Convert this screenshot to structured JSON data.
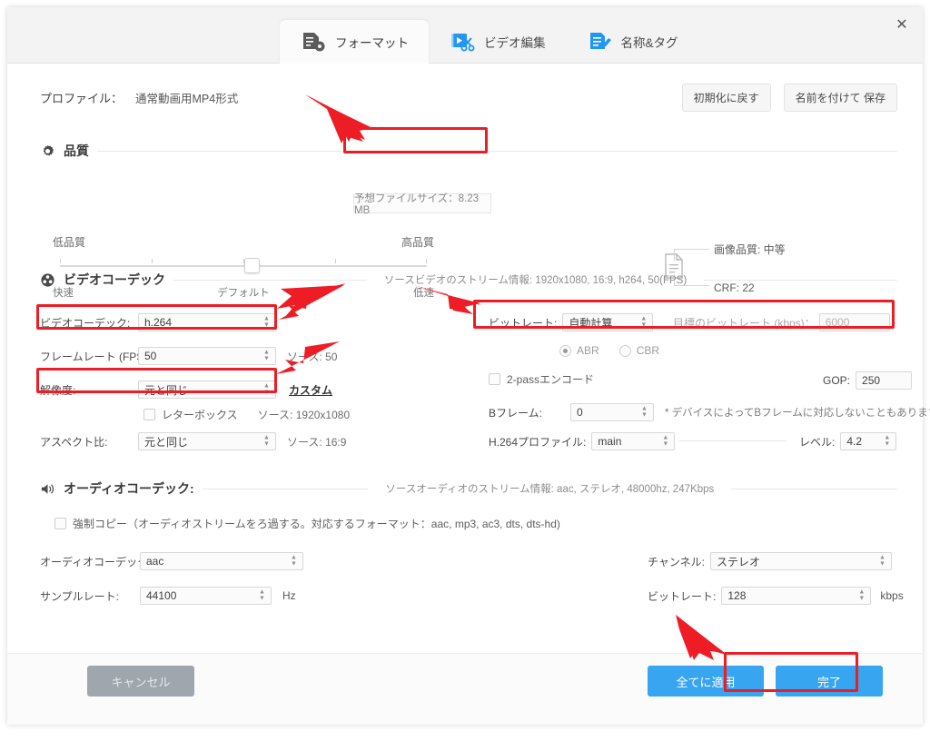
{
  "window": {
    "close_label": "✕"
  },
  "tabs": [
    {
      "label": "フォーマット",
      "icon": "format-icon",
      "active": true
    },
    {
      "label": "ビデオ編集",
      "icon": "video-edit-icon",
      "active": false
    },
    {
      "label": "名称&タグ",
      "icon": "name-tag-icon",
      "active": false
    }
  ],
  "profile": {
    "label": "プロファイル：",
    "value": "通常動画用MP4形式"
  },
  "top_buttons": {
    "reset": "初期化に戻す",
    "save_as": "名前を付けて 保存"
  },
  "quality": {
    "section_title": "品質",
    "estimate": "予想ファイルサイズ：8.23 MB",
    "slider": {
      "left_top": "低品質",
      "right_top": "高品質",
      "left_bottom": "快速",
      "center_bottom": "デフォルト",
      "right_bottom": "低速",
      "value_percent": 50
    },
    "info": {
      "image_quality": "画像品質: 中等",
      "crf": "CRF: 22"
    }
  },
  "video": {
    "section_title": "ビデオコーデック",
    "source_info": "ソースビデオのストリーム情報: 1920x1080, 16:9, h264, 50(FPS)",
    "codec": {
      "label": "ビデオコーデック:",
      "value": "h.264"
    },
    "framerate": {
      "label": "フレームレート (FPS)：",
      "value": "50",
      "source": "ソース: 50"
    },
    "resolution": {
      "label": "解像度:",
      "value": "元と同じ",
      "custom_link": "カスタム",
      "source": "ソース: 1920x1080"
    },
    "letterbox": {
      "label": "レターボックス",
      "checked": false
    },
    "aspect": {
      "label": "アスペクト比:",
      "value": "元と同じ",
      "source": "ソース: 16:9"
    },
    "bitrate_mode": {
      "label": "ビットレート:",
      "value": "自動計算"
    },
    "target_bitrate": {
      "label": "目標のビットレート (kbps)：",
      "value": "6000"
    },
    "abr": {
      "label": "ABR",
      "checked": true
    },
    "cbr": {
      "label": "CBR",
      "checked": false
    },
    "two_pass": {
      "label": "2-passエンコード",
      "checked": false
    },
    "gop": {
      "label": "GOP:",
      "value": "250"
    },
    "bframe": {
      "label": "Bフレーム:",
      "value": "0",
      "note": "* デバイスによってBフレームに対応しないこともあります。"
    },
    "h264_profile": {
      "label": "H.264プロファイル:",
      "value": "main"
    },
    "level": {
      "label": "レベル:",
      "value": "4.2"
    }
  },
  "audio": {
    "section_title": "オーディオコーデック:",
    "source_info": "ソースオーディオのストリーム情報: aac, ステレオ, 48000hz, 247Kbps",
    "force_copy": {
      "label": "強制コピー（オーディオストリームをろ過する。対応するフォーマット：aac, mp3, ac3, dts, dts-hd)",
      "checked": false
    },
    "codec": {
      "label": "オーディオコーデック:",
      "value": "aac"
    },
    "sample_rate": {
      "label": "サンプルレート:",
      "value": "44100",
      "unit": "Hz"
    },
    "channel": {
      "label": "チャンネル:",
      "value": "ステレオ"
    },
    "bitrate": {
      "label": "ビットレート:",
      "value": "128",
      "unit": "kbps"
    }
  },
  "footer": {
    "cancel": "キャンセル",
    "apply_all": "全てに適用",
    "finish": "完了"
  },
  "colors": {
    "accent_blue": "#37a5f0",
    "annotation_red": "#ee1c25",
    "cancel_gray": "#9fa6ad"
  }
}
